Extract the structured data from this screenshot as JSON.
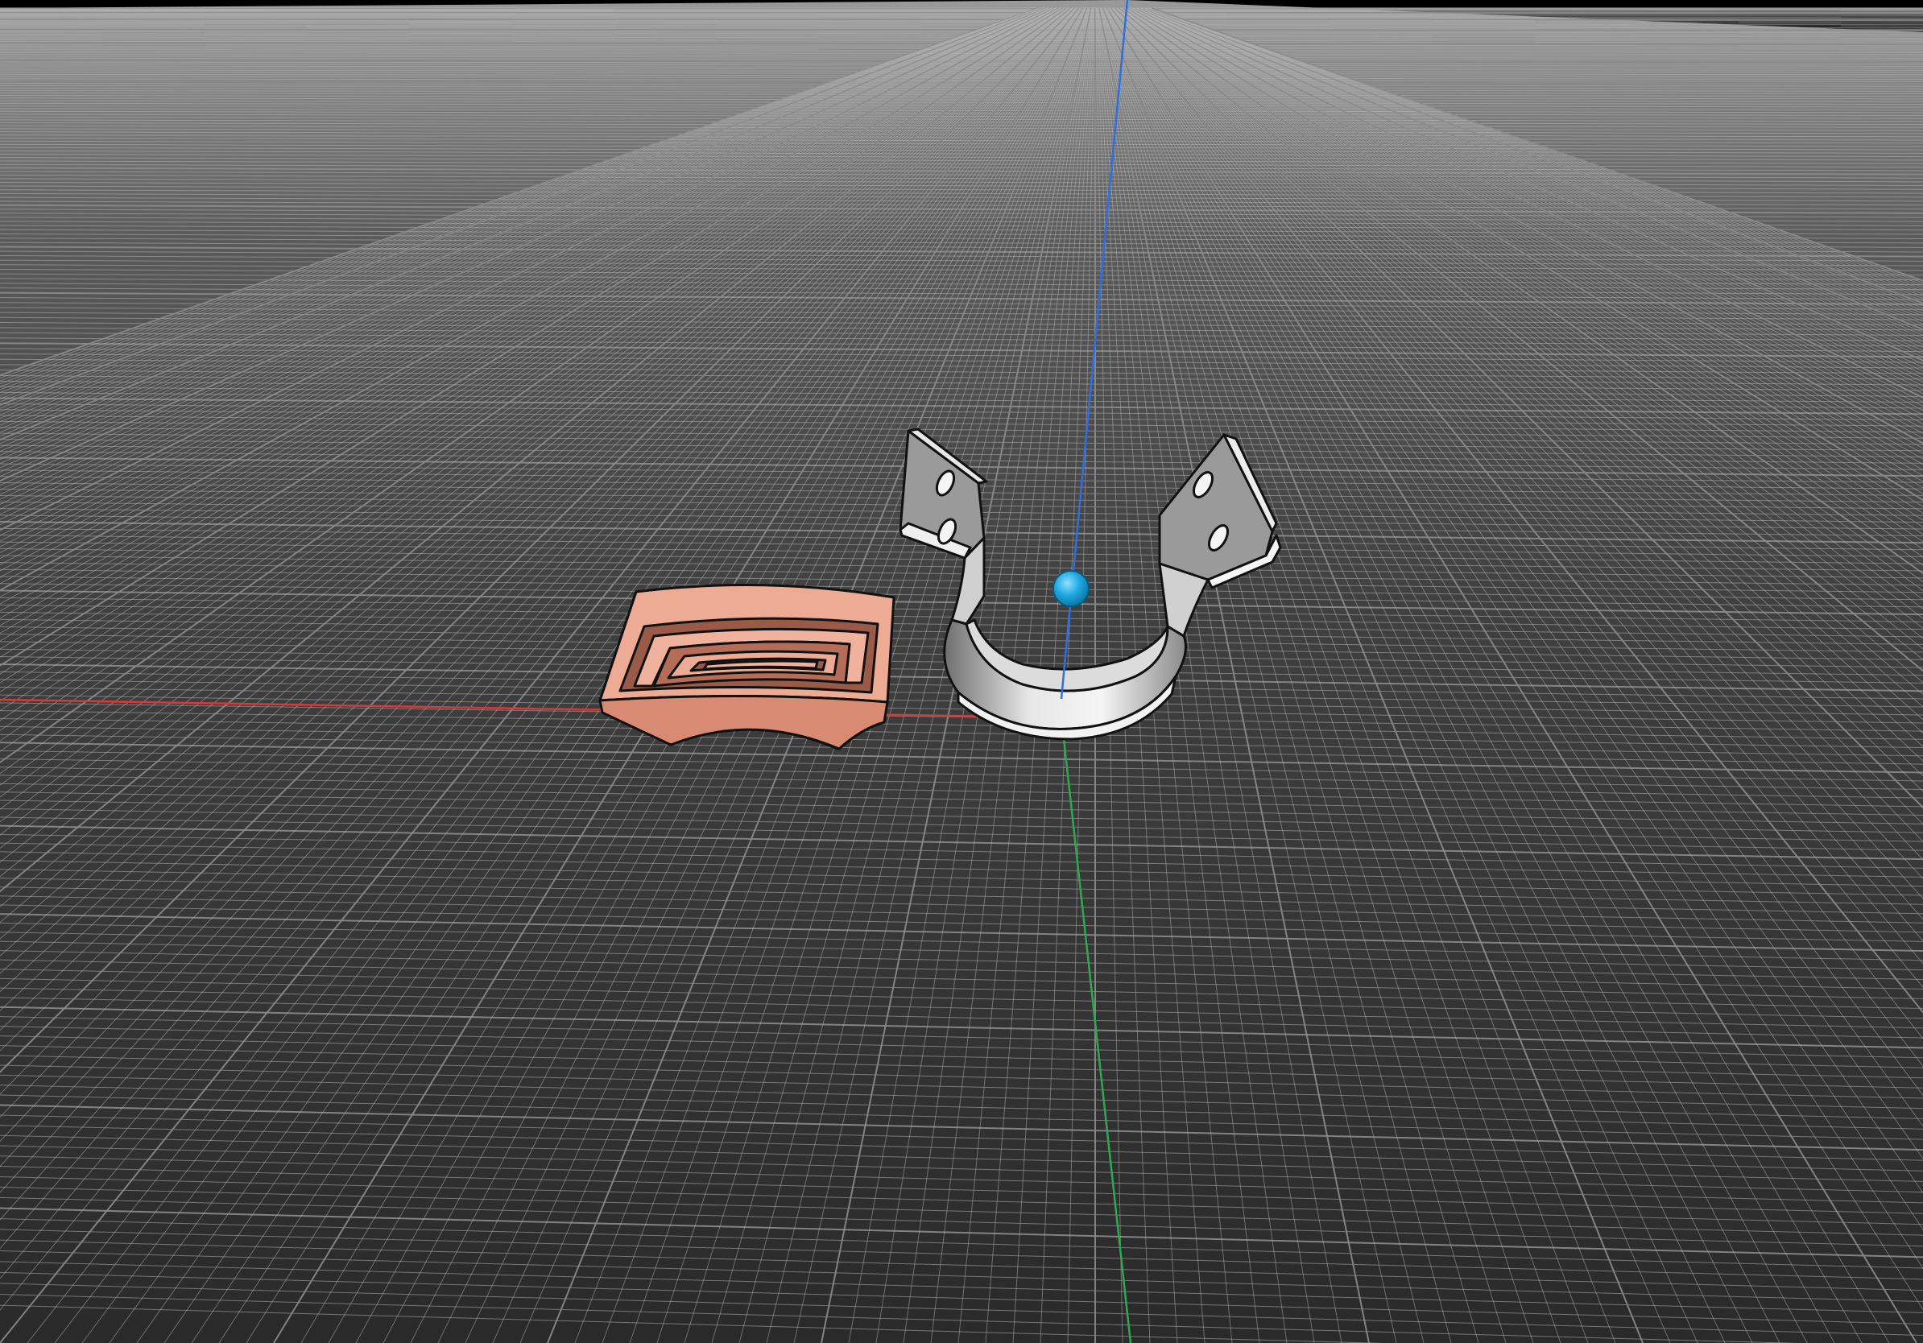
{
  "viewport": {
    "background_color": "#000000",
    "ground_color": "#3a3a3a",
    "grid_minor_color": "#b4b4b4",
    "grid_major_color": "#8c8c8c"
  },
  "axes": {
    "x_axis_color": "#d63a3a",
    "y_axis_color": "#2fa84f",
    "z_axis_color": "#2f6fe0"
  },
  "objects": [
    {
      "name": "spiral-block",
      "face_color": "#e8a28a",
      "side_color": "#d98a72",
      "shadow_color": "#9a5a48",
      "outline_color": "#111111"
    },
    {
      "name": "u-bracket",
      "face_color": "#c9c9c9",
      "light_color": "#f2f2f2",
      "dark_color": "#8f8f8f",
      "outline_color": "#111111"
    }
  ],
  "pivot": {
    "color": "#1ea8e0"
  }
}
